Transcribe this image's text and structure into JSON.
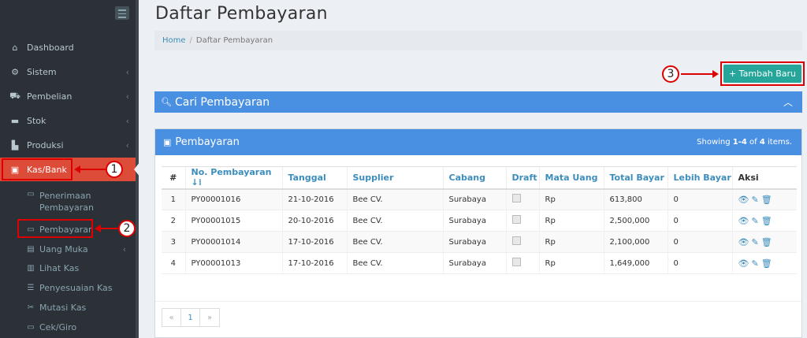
{
  "sidebar": {
    "items": [
      {
        "label": "Dashboard",
        "icon": "home-icon",
        "glyph": "⌂"
      },
      {
        "label": "Sistem",
        "icon": "gears-icon",
        "glyph": "⚙"
      },
      {
        "label": "Pembelian",
        "icon": "cart-icon",
        "glyph": "⛟"
      },
      {
        "label": "Stok",
        "icon": "stock-icon",
        "glyph": "▬"
      },
      {
        "label": "Produksi",
        "icon": "chart-icon",
        "glyph": "▙"
      },
      {
        "label": "Kas/Bank",
        "icon": "money-icon",
        "glyph": "▣"
      }
    ],
    "subitems": [
      {
        "label": "Penerimaan Pembayaran",
        "glyph": "▭"
      },
      {
        "label": "Pembayaran",
        "glyph": "▭"
      },
      {
        "label": "Uang Muka",
        "glyph": "▤"
      },
      {
        "label": "Lihat Kas",
        "glyph": "▥"
      },
      {
        "label": "Penyesuaian Kas",
        "glyph": "☰"
      },
      {
        "label": "Mutasi Kas",
        "glyph": "✂"
      },
      {
        "label": "Cek/Giro",
        "glyph": "▭"
      }
    ]
  },
  "annotations": [
    "1",
    "2",
    "3"
  ],
  "header": {
    "title": "Daftar Pembayaran",
    "breadcrumb": {
      "home": "Home",
      "separator": "/",
      "current": "Daftar Pembayaran"
    }
  },
  "actions": {
    "add_label": "+ Tambah Baru"
  },
  "search": {
    "title": "Cari Pembayaran",
    "icon_glyph": "🔍︎",
    "chevron": "︿"
  },
  "panel": {
    "title": "Pembayaran",
    "summary_prefix": "Showing ",
    "summary_range": "1-4",
    "summary_mid": " of ",
    "summary_total": "4",
    "summary_suffix": " items."
  },
  "table": {
    "headers": [
      "#",
      "No. Pembayaran ↓⁞",
      "Tanggal",
      "Supplier",
      "Cabang",
      "Draft",
      "Mata Uang",
      "Total Bayar",
      "Lebih Bayar",
      "Aksi"
    ],
    "rows": [
      [
        "1",
        "PY00001016",
        "21-10-2016",
        "Bee CV.",
        "Surabaya",
        "",
        "Rp",
        "613,800",
        "0",
        "👁 ✎ 🗑"
      ],
      [
        "2",
        "PY00001015",
        "20-10-2016",
        "Bee CV.",
        "Surabaya",
        "",
        "Rp",
        "2,500,000",
        "0",
        "👁 ✎ 🗑"
      ],
      [
        "3",
        "PY00001014",
        "17-10-2016",
        "Bee CV.",
        "Surabaya",
        "",
        "Rp",
        "2,100,000",
        "0",
        "👁 ✎ 🗑"
      ],
      [
        "4",
        "PY00001013",
        "17-10-2016",
        "Bee CV.",
        "Surabaya",
        "",
        "Rp",
        "1,649,000",
        "0",
        "👁 ✎ 🗑"
      ]
    ]
  },
  "pagination": [
    "«",
    "1",
    "»"
  ]
}
